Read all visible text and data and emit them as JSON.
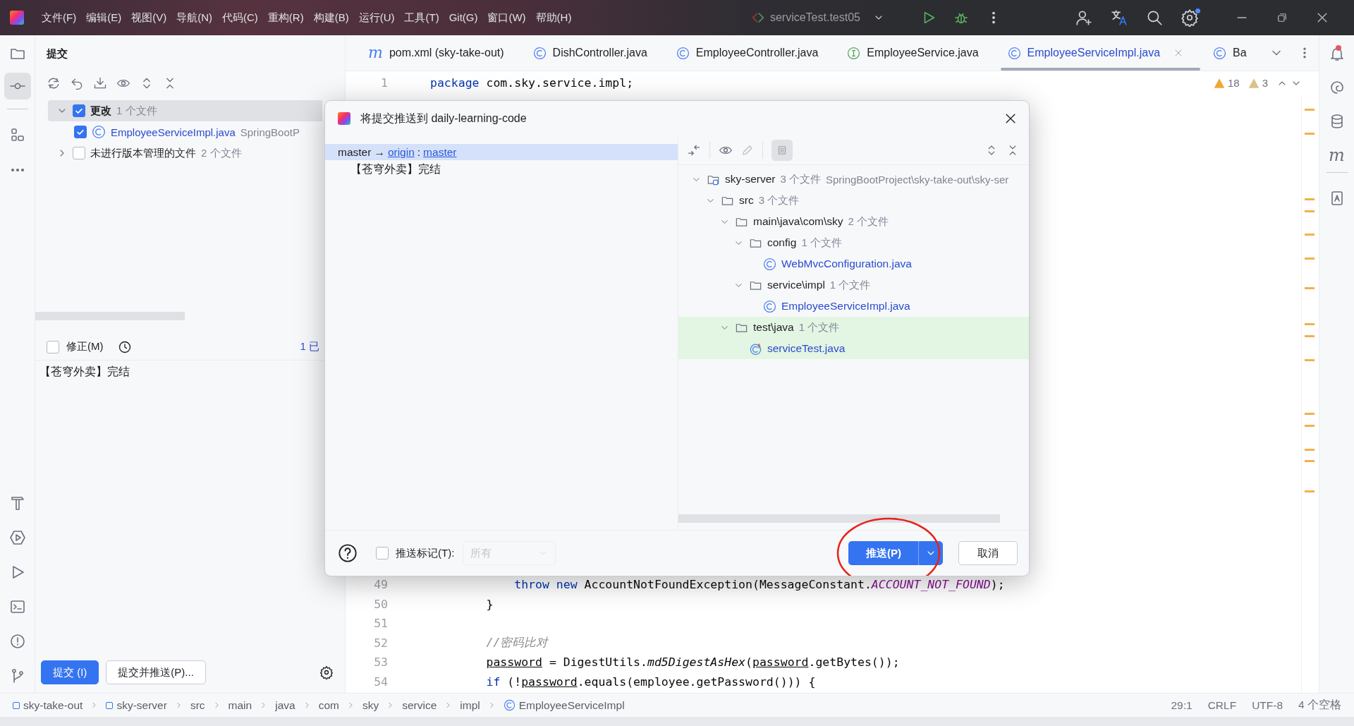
{
  "title_bar": {
    "menus": [
      "文件(F)",
      "编辑(E)",
      "视图(V)",
      "导航(N)",
      "代码(C)",
      "重构(R)",
      "构建(B)",
      "运行(U)",
      "工具(T)",
      "Git(G)",
      "窗口(W)",
      "帮助(H)"
    ],
    "run_config": "serviceTest.test05"
  },
  "commit_panel": {
    "title": "提交",
    "tree": [
      {
        "label": "更改",
        "count": "1 个文件",
        "checked": true,
        "expanded": true,
        "selected": true,
        "children": [
          {
            "label": "EmployeeServiceImpl.java",
            "path": "SpringBootP",
            "checked": true,
            "selected": false,
            "kind": "class"
          }
        ]
      },
      {
        "label": "未进行版本管理的文件",
        "count": "2 个文件",
        "checked": false,
        "expanded": false,
        "selected": false
      }
    ],
    "amend": {
      "label": "修正(M)",
      "checked": false
    },
    "summary": "1 已",
    "message": "【苍穹外卖】完结",
    "buttons": [
      {
        "label": "提交 (I)",
        "primary": true
      },
      {
        "label": "提交并推送(P)...",
        "primary": false
      }
    ]
  },
  "editor": {
    "tabs": [
      {
        "label": "pom.xml (sky-take-out)",
        "kind": "maven",
        "glyph": "m",
        "selected": false
      },
      {
        "label": "DishController.java",
        "kind": "class",
        "selected": false
      },
      {
        "label": "EmployeeController.java",
        "kind": "class",
        "selected": false
      },
      {
        "label": "EmployeeService.java",
        "kind": "interface",
        "selected": false
      },
      {
        "label": "EmployeeServiceImpl.java",
        "kind": "class",
        "selected": true
      },
      {
        "label": "Ba",
        "kind": "class",
        "selected": false
      }
    ],
    "warnings": "18",
    "weak_warnings": "3",
    "sticky_lines": [
      {
        "number": "1",
        "kind": "top",
        "segments": [
          {
            "kind": "keyword",
            "text": "package"
          },
          {
            "kind": "plain",
            "text": " com.sky.service.impl;"
          }
        ]
      }
    ],
    "lines": [
      {
        "number": "49",
        "kind": "nested",
        "segments": [
          {
            "kind": "keyword",
            "text": "throw new"
          },
          {
            "kind": "plain",
            "text": " AccountNotFoundException(MessageConstant."
          },
          {
            "kind": "constant",
            "text": "ACCOUNT_NOT_FOUND"
          },
          {
            "kind": "plain",
            "text": ");"
          }
        ]
      },
      {
        "number": "50",
        "kind": "body",
        "segments": [
          {
            "kind": "plain",
            "text": "}"
          }
        ]
      },
      {
        "number": "51",
        "kind": "body"
      },
      {
        "number": "52",
        "kind": "body",
        "segments": [
          {
            "kind": "comment",
            "text": "//密码比对"
          }
        ]
      },
      {
        "number": "53",
        "kind": "body",
        "segments": [
          {
            "kind": "reassigned",
            "text": "password"
          },
          {
            "kind": "plain",
            "text": " = DigestUtils."
          },
          {
            "kind": "static",
            "text": "md5DigestAsHex"
          },
          {
            "kind": "plain",
            "text": "("
          },
          {
            "kind": "reassigned",
            "text": "password"
          },
          {
            "kind": "plain",
            "text": ".getBytes());"
          }
        ]
      },
      {
        "number": "54",
        "kind": "body",
        "segments": [
          {
            "kind": "keyword",
            "text": "if"
          },
          {
            "kind": "plain",
            "text": " (!"
          },
          {
            "kind": "reassigned",
            "text": "password"
          },
          {
            "kind": "plain",
            "text": ".equals(employee.getPassword())) {"
          }
        ]
      }
    ]
  },
  "side_glyph": "m",
  "dialog": {
    "title": "将提交推送到 daily-learning-code",
    "commits": [
      {
        "kind": "branch",
        "local": "master",
        "arrow": "→",
        "remote": "origin",
        "separator": ":",
        "remote_branch": "master",
        "selected": true
      },
      {
        "kind": "commit",
        "text": "【苍穹外卖】完结",
        "selected": false
      }
    ],
    "files": [
      {
        "label": "sky-server",
        "count": "3 个文件",
        "path": "SpringBootProject\\sky-take-out\\sky-ser",
        "kind": "module",
        "expanded": true,
        "added": false,
        "children": [
          {
            "label": "src",
            "count": "3 个文件",
            "kind": "folder",
            "expanded": true,
            "added": false,
            "children": [
              {
                "label": "main\\java\\com\\sky",
                "count": "2 个文件",
                "kind": "folder",
                "expanded": true,
                "added": false,
                "children": [
                  {
                    "label": "config",
                    "count": "1 个文件",
                    "kind": "folder",
                    "expanded": true,
                    "added": false,
                    "children": [
                      {
                        "label": "WebMvcConfiguration.java",
                        "kind": "class",
                        "added": false
                      }
                    ]
                  },
                  {
                    "label": "service\\impl",
                    "count": "1 个文件",
                    "kind": "folder",
                    "expanded": true,
                    "added": false,
                    "children": [
                      {
                        "label": "EmployeeServiceImpl.java",
                        "kind": "class",
                        "added": false
                      }
                    ]
                  }
                ]
              },
              {
                "label": "test\\java",
                "count": "1 个文件",
                "kind": "folder",
                "expanded": true,
                "added": true,
                "children": [
                  {
                    "label": "serviceTest.java",
                    "kind": "test-class",
                    "added": true
                  }
                ]
              }
            ]
          }
        ]
      }
    ],
    "push_tags": {
      "label": "推送标记(T):",
      "checked": false,
      "value": "所有",
      "disabled": true
    },
    "buttons": [
      {
        "label": "推送(P)",
        "primary": true,
        "split": true
      },
      {
        "label": "取消",
        "primary": false,
        "split": false
      }
    ],
    "annotations": [
      {
        "kind": "ellipse"
      }
    ]
  },
  "status_bar": {
    "breadcrumbs": [
      {
        "label": "sky-take-out",
        "kind": "module"
      },
      {
        "label": "sky-server",
        "kind": "module"
      },
      {
        "label": "src",
        "kind": "folder"
      },
      {
        "label": "main",
        "kind": "folder"
      },
      {
        "label": "java",
        "kind": "folder"
      },
      {
        "label": "com",
        "kind": "folder"
      },
      {
        "label": "sky",
        "kind": "folder"
      },
      {
        "label": "service",
        "kind": "folder"
      },
      {
        "label": "impl",
        "kind": "folder"
      },
      {
        "label": "EmployeeServiceImpl",
        "kind": "class"
      }
    ],
    "position": "29:1",
    "line_separator": "CRLF",
    "encoding": "UTF-8",
    "indent": "4 个空格"
  }
}
